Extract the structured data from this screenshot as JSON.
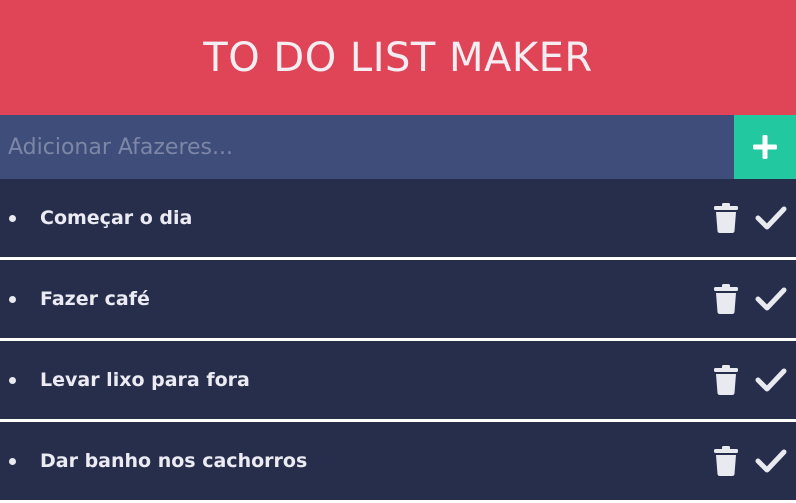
{
  "header": {
    "title": "TO DO LIST MAKER"
  },
  "input": {
    "placeholder": "Adicionar Afazeres...",
    "value": ""
  },
  "add_button": {
    "icon": "plus-icon"
  },
  "todos": [
    {
      "label": "Começar o dia"
    },
    {
      "label": "Fazer café"
    },
    {
      "label": "Levar lixo para fora"
    },
    {
      "label": "Dar banho nos cachorros"
    }
  ],
  "icons": {
    "delete": "trash-icon",
    "complete": "check-icon"
  },
  "colors": {
    "header_bg": "#e04457",
    "input_bg": "#3f4d7a",
    "add_btn_bg": "#22c9a0",
    "item_bg": "#262e4c",
    "text": "#ecebf3"
  }
}
